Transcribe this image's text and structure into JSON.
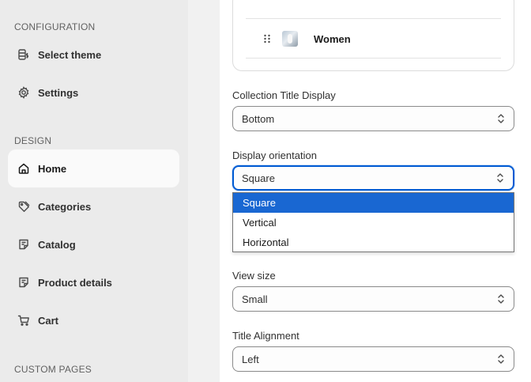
{
  "sidebar": {
    "sections": [
      {
        "heading": "CONFIGURATION",
        "items": [
          {
            "label": "Select theme",
            "icon": "theme-icon",
            "active": false
          },
          {
            "label": "Settings",
            "icon": "gear-icon",
            "active": false
          }
        ]
      },
      {
        "heading": "DESIGN",
        "items": [
          {
            "label": "Home",
            "icon": "home-icon",
            "active": true
          },
          {
            "label": "Categories",
            "icon": "tag-icon",
            "active": false
          },
          {
            "label": "Catalog",
            "icon": "catalog-icon",
            "active": false
          },
          {
            "label": "Product details",
            "icon": "product-icon",
            "active": false
          },
          {
            "label": "Cart",
            "icon": "cart-icon",
            "active": false
          }
        ]
      },
      {
        "heading": "CUSTOM PAGES",
        "items": []
      }
    ]
  },
  "panel": {
    "collection_list": {
      "items": [
        {
          "name": "Women",
          "icon": "drag-handle-icon"
        }
      ]
    },
    "fields": {
      "collection_title_display": {
        "label": "Collection Title Display",
        "value": "Bottom"
      },
      "display_orientation": {
        "label": "Display orientation",
        "value": "Square",
        "open": true,
        "options": [
          "Square",
          "Vertical",
          "Horizontal"
        ],
        "selected_index": 0
      },
      "view_size": {
        "label": "View size",
        "value": "Small"
      },
      "title_alignment": {
        "label": "Title Alignment",
        "value": "Left"
      }
    }
  },
  "colors": {
    "sidebar_bg": "#ebebeb",
    "panel_bg": "#ffffff",
    "focus_border": "#005bd3",
    "dropdown_highlight": "#1967d2"
  }
}
